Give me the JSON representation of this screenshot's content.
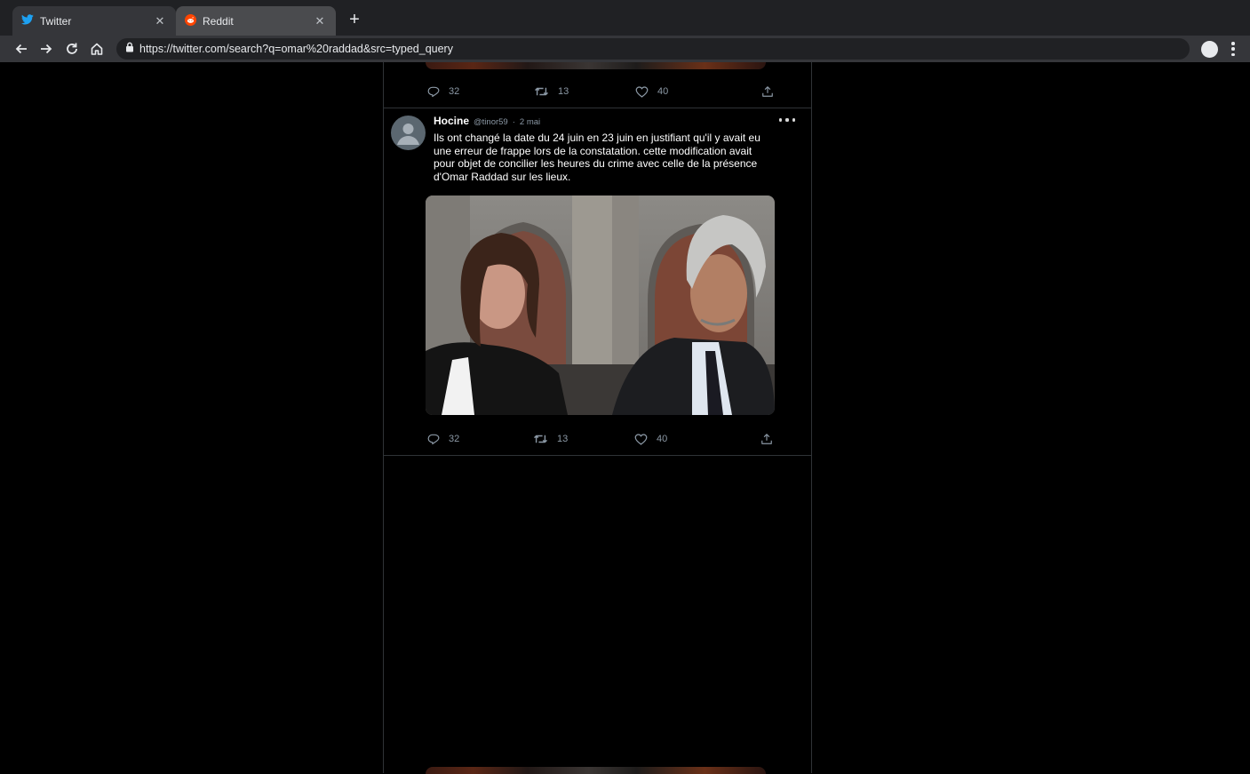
{
  "browser": {
    "tabs": [
      {
        "title": "Twitter",
        "favicon": "twitter-bird-icon",
        "active": true
      },
      {
        "title": "Reddit",
        "favicon": "reddit-icon",
        "active": false
      }
    ],
    "url": "https://twitter.com/search?q=omar%20raddad&src=typed_query"
  },
  "previous_tweet": {
    "replies": "32",
    "retweets": "13",
    "likes": "40"
  },
  "tweet": {
    "author_name": "Hocine",
    "author_handle": "@tinor59",
    "separator": "·",
    "date": "2 mai",
    "text": "Ils ont changé la date du 24 juin en 23 juin en justifiant qu'il y avait eu une erreur de frappe lors de la constatation. cette modification avait pour objet de concilier les heures du crime avec celle de la présence d'Omar Raddad sur les lieux.",
    "replies": "32",
    "retweets": "13",
    "likes": "40"
  },
  "colors": {
    "background": "#000000",
    "chrome_dark": "#202124",
    "chrome_toolbar": "#35363a",
    "muted_text": "#8b98a5",
    "border": "#2f3336",
    "twitter_blue": "#1da1f2",
    "reddit_orange": "#ff4500"
  }
}
